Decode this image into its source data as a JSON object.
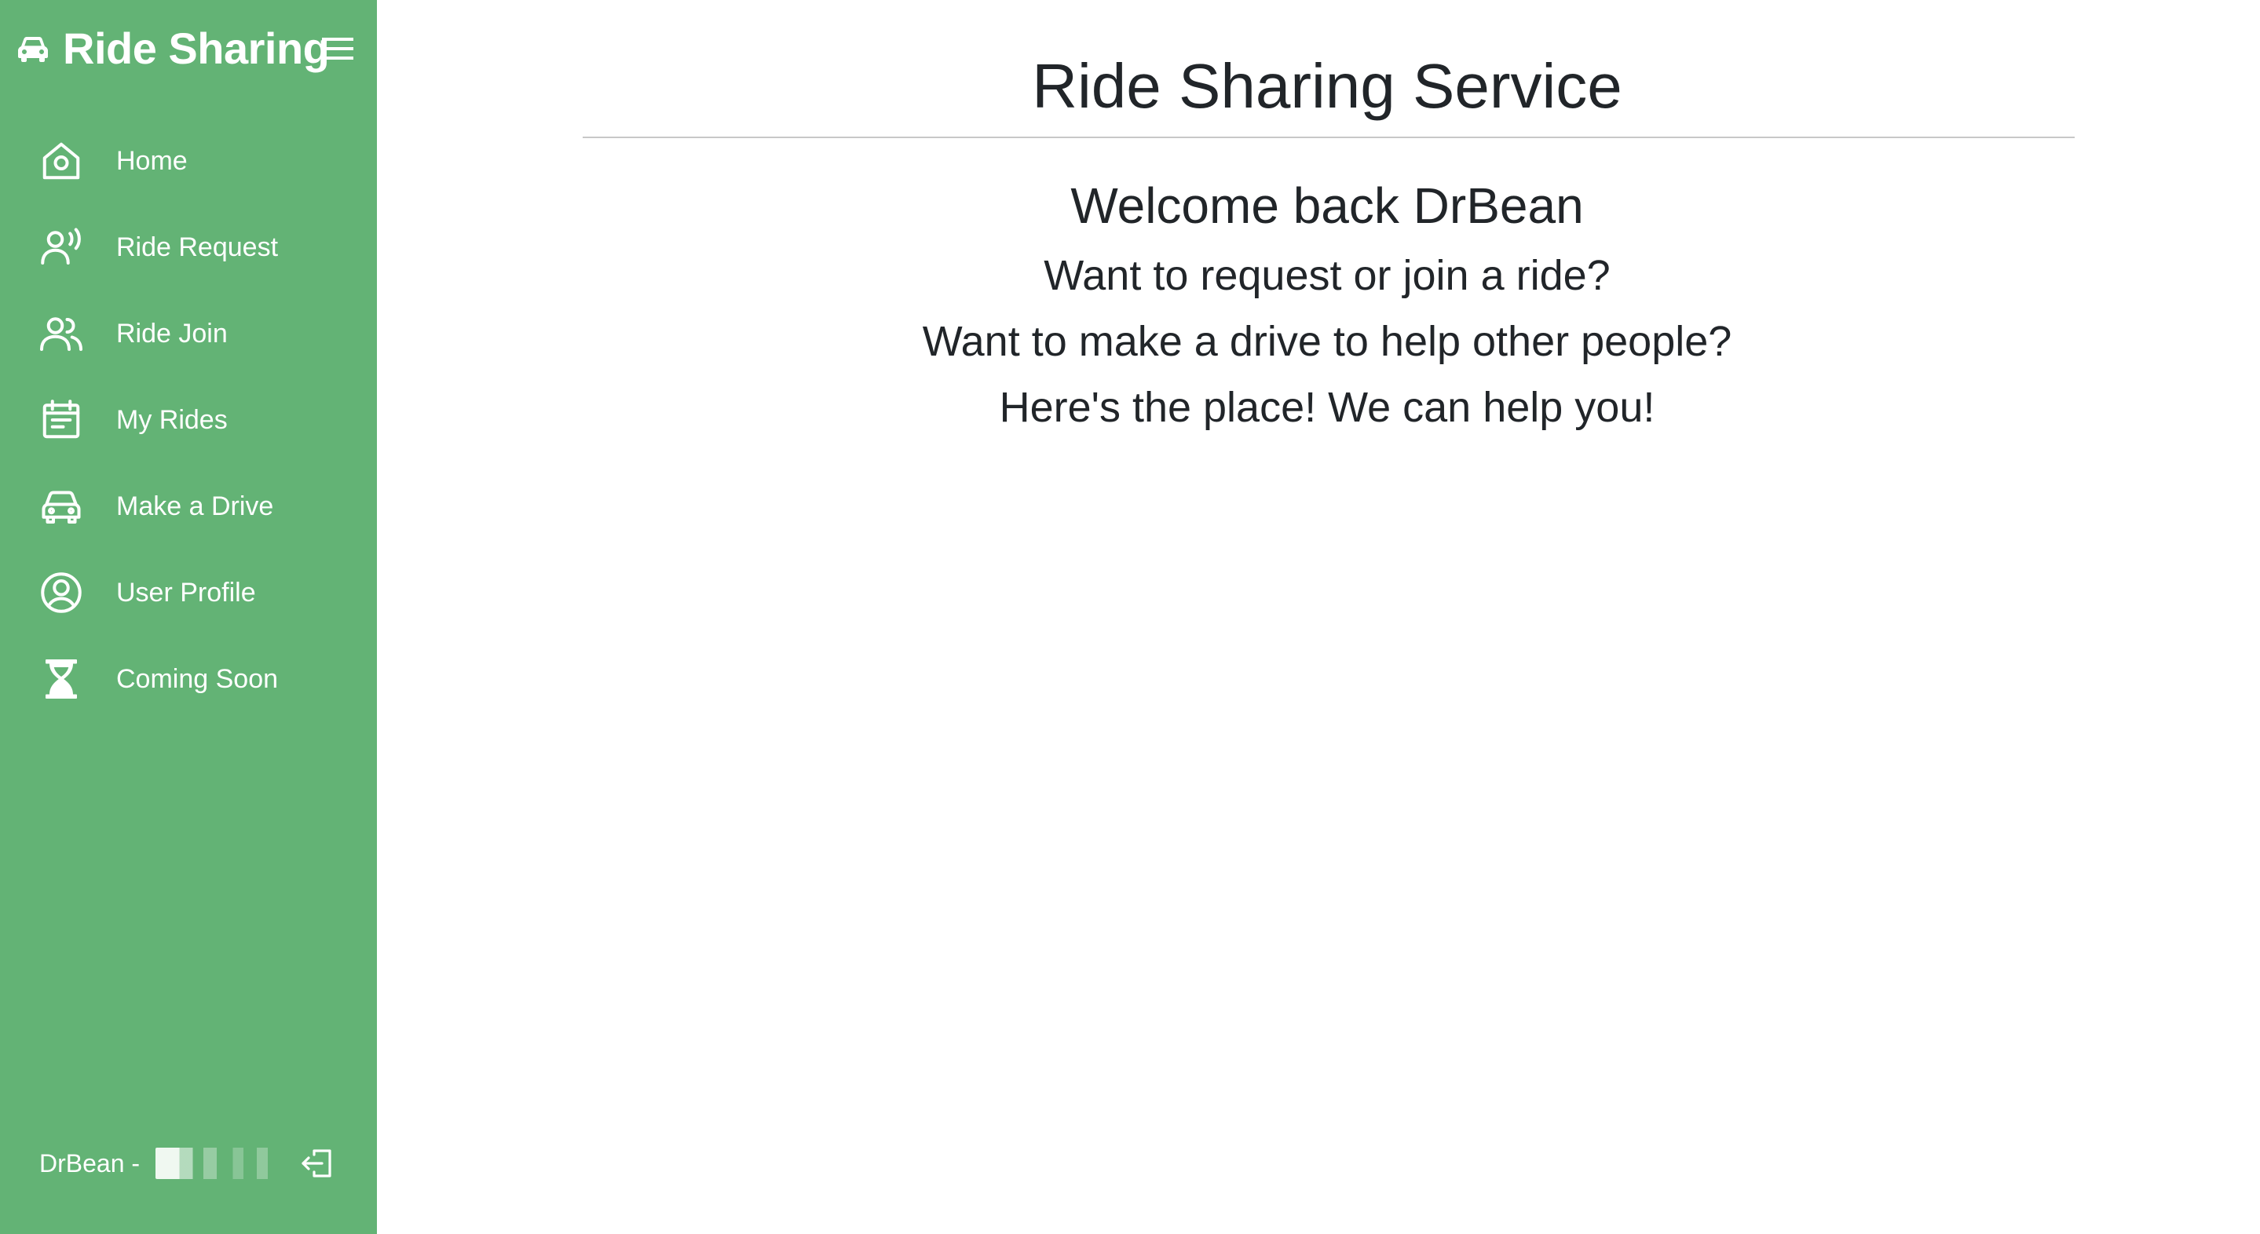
{
  "sidebar": {
    "brand_title": "Ride Sharing",
    "brand_icon": "car-icon",
    "menu_icon": "hamburger-menu-icon",
    "background_color": "#63b375",
    "items": [
      {
        "label": "Home",
        "icon": "home-icon"
      },
      {
        "label": "Ride Request",
        "icon": "person-voice-icon"
      },
      {
        "label": "Ride Join",
        "icon": "people-icon"
      },
      {
        "label": "My Rides",
        "icon": "calendar-icon"
      },
      {
        "label": "Make a Drive",
        "icon": "car-icon"
      },
      {
        "label": "User Profile",
        "icon": "person-circle-icon"
      },
      {
        "label": "Coming Soon",
        "icon": "hourglass-icon"
      }
    ],
    "footer": {
      "user_label": "DrBean -",
      "logout_icon": "box-arrow-in-left-icon"
    }
  },
  "main": {
    "title": "Ride Sharing Service",
    "welcome": "Welcome back DrBean",
    "lines": [
      "Want to request or join a ride?",
      "Want to make a drive to help other people?",
      "Here's the place! We can help you!"
    ]
  }
}
